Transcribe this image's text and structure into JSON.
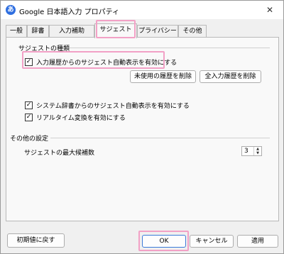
{
  "window": {
    "app_icon_glyph": "あ",
    "title": "Google 日本語入力 プロパティ",
    "close_glyph": "✕"
  },
  "tabs": [
    {
      "label": "一般",
      "active": false
    },
    {
      "label": "辞書",
      "active": false
    },
    {
      "label": "入力補助",
      "active": false
    },
    {
      "label": "サジェスト",
      "active": true
    },
    {
      "label": "プライバシー",
      "active": false
    },
    {
      "label": "その他",
      "active": false
    }
  ],
  "suggest_group": {
    "title": "サジェストの種類",
    "history_checkbox": {
      "label": "入力履歴からのサジェスト自動表示を有効にする",
      "checked": true
    },
    "clear_unused_history_button": "未使用の履歴を削除",
    "clear_all_history_button": "全入力履歴を削除",
    "system_dict_checkbox": {
      "label": "システム辞書からのサジェスト自動表示を有効にする",
      "checked": true
    },
    "realtime_checkbox": {
      "label": "リアルタイム変換を有効にする",
      "checked": true
    }
  },
  "other_group": {
    "title": "その他の設定",
    "max_candidates_label": "サジェストの最大候補数",
    "max_candidates_value": "3"
  },
  "footer": {
    "reset_button": "初期値に戻す",
    "ok_button": "OK",
    "cancel_button": "キャンセル",
    "apply_button": "適用"
  },
  "check_glyph": "✓",
  "spin_up_glyph": "▲",
  "spin_down_glyph": "▼",
  "colors": {
    "highlight": "#f2a1c6",
    "primary_border": "#3b7ad8",
    "icon_blue": "#2f6fe0"
  }
}
